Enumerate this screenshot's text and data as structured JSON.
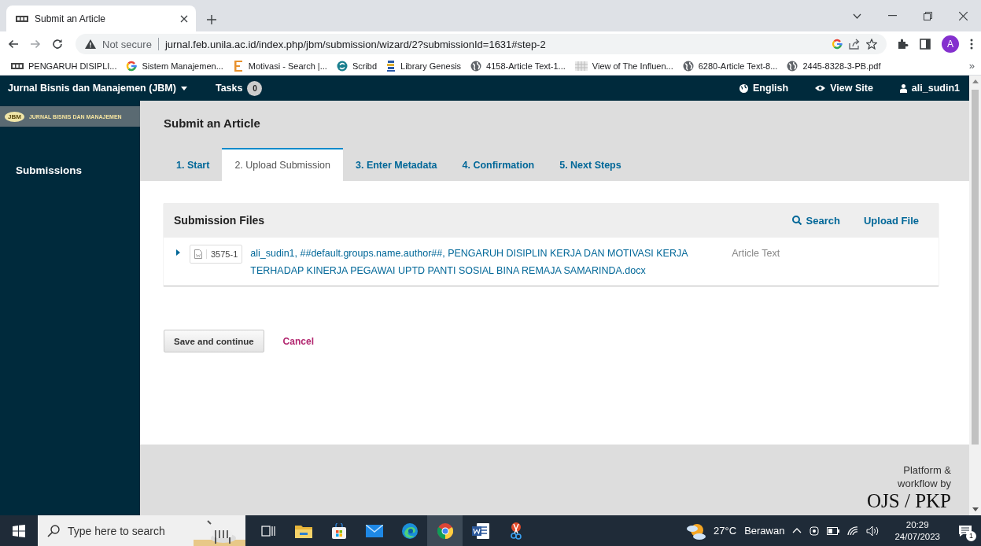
{
  "browser": {
    "tabs": [
      {
        "title": "Submit an Article",
        "selected": true
      }
    ],
    "address": {
      "security": "Not secure",
      "url": "jurnal.feb.unila.ac.id/index.php/jbm/submission/wizard/2?submissionId=1631#step-2"
    },
    "profile_initial": "A",
    "bookmarks": [
      {
        "label": "PENGARUH DISIPLI...",
        "kind": "site"
      },
      {
        "label": "Sistem Manajemen...",
        "kind": "ring"
      },
      {
        "label": "Motivasi - Search |...",
        "kind": "letter"
      },
      {
        "label": "Scribd",
        "kind": "circle"
      },
      {
        "label": "Library Genesis",
        "kind": "books"
      },
      {
        "label": "4158-Article Text-1...",
        "kind": "globe"
      },
      {
        "label": "View of The Influen...",
        "kind": "grid"
      },
      {
        "label": "6280-Article Text-8...",
        "kind": "globe"
      },
      {
        "label": "2445-8328-3-PB.pdf",
        "kind": "globe"
      }
    ],
    "more_bookmarks": "»"
  },
  "ojs": {
    "journal_menu": "Jurnal Bisnis dan Manajemen (JBM)",
    "tasks": {
      "label": "Tasks",
      "count": "0"
    },
    "language": "English",
    "view_site": "View Site",
    "user": "ali_sudin1",
    "logo": {
      "badge": "JBM",
      "title": "JURNAL BISNIS DAN MANAJEMEN"
    },
    "sidebar": {
      "items": [
        {
          "label": "Submissions"
        }
      ]
    },
    "page_title": "Submit an Article",
    "steps": [
      {
        "label": "1. Start",
        "selected": false
      },
      {
        "label": "2. Upload Submission",
        "selected": true
      },
      {
        "label": "3. Enter Metadata",
        "selected": false
      },
      {
        "label": "4. Confirmation",
        "selected": false
      },
      {
        "label": "5. Next Steps",
        "selected": false
      }
    ],
    "files_panel": {
      "title": "Submission Files",
      "search": "Search",
      "upload": "Upload File",
      "rows": [
        {
          "expanded": false,
          "file_id": "3575-1",
          "name": "ali_sudin1, ##default.groups.name.author##, PENGARUH DISIPLIN KERJA DAN MOTIVASI KERJA TERHADAP KINERJA PEGAWAI UPTD PANTI SOSIAL BINA REMAJA SAMARINDA.docx",
          "genre": "Article Text"
        }
      ]
    },
    "save_button": "Save and continue",
    "cancel_link": "Cancel",
    "footer": {
      "credit": "Platform & workflow by",
      "brand": "OJS / PKP"
    }
  },
  "taskbar": {
    "search": {
      "placeholder": "Type here to search"
    },
    "apps": [
      {
        "kind": "taskview",
        "selected": false
      },
      {
        "kind": "folder",
        "selected": false
      },
      {
        "kind": "store",
        "selected": false
      },
      {
        "kind": "mail",
        "selected": false
      },
      {
        "kind": "edge",
        "selected": false
      },
      {
        "kind": "chrome",
        "selected": true
      },
      {
        "kind": "word",
        "selected": false
      },
      {
        "kind": "snip",
        "selected": false
      }
    ],
    "weather": {
      "temperature": "27°C",
      "condition": "Berawan"
    },
    "time": "20:29",
    "date": "24/07/2023",
    "notifications": "1"
  }
}
